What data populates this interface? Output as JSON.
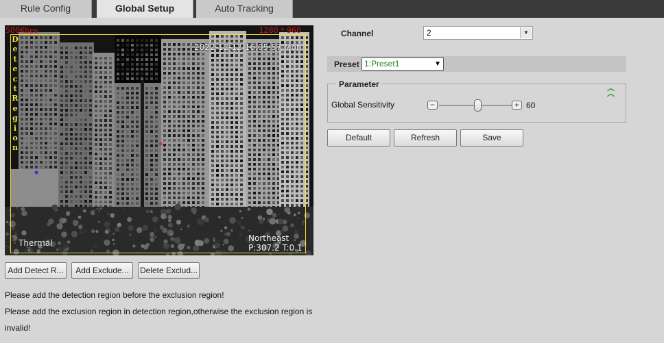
{
  "tabs": [
    {
      "label": "Rule Config",
      "active": false
    },
    {
      "label": "Global Setup",
      "active": true
    },
    {
      "label": "Auto Tracking",
      "active": false
    }
  ],
  "video": {
    "bitrate": "500Kbps",
    "resolution": "1280 * 960",
    "timestamp": "2022-12-12 16:05:57 Mon",
    "mode_label": "Thermal",
    "direction": "Northeast",
    "ptz": "P:307.2 T:0.1",
    "region_label": "Detect Region",
    "region_color": "#f1e23a"
  },
  "region_buttons": {
    "add_detect": "Add Detect R...",
    "add_exclude": "Add Exclude...",
    "delete_exclude": "Delete Exclud..."
  },
  "notes": {
    "line1": "Please add the detection region before the exclusion region!",
    "line2": "Please add the exclusion region in detection region,otherwise the exclusion region is",
    "line3": "invalid!"
  },
  "channel": {
    "label": "Channel",
    "value": "2"
  },
  "preset": {
    "label": "Preset",
    "value": "1:Preset1"
  },
  "parameter": {
    "legend": "Parameter",
    "sensitivity_label": "Global Sensitivity",
    "sensitivity_value": "60",
    "sensitivity_fraction": 0.6
  },
  "actions": {
    "default": "Default",
    "refresh": "Refresh",
    "save": "Save"
  },
  "colors": {
    "topbar": "#3a3a3a",
    "panel_bg": "#d6d6d6",
    "preset_green": "#1a8a1a",
    "collapse_green": "#1e9a38"
  }
}
